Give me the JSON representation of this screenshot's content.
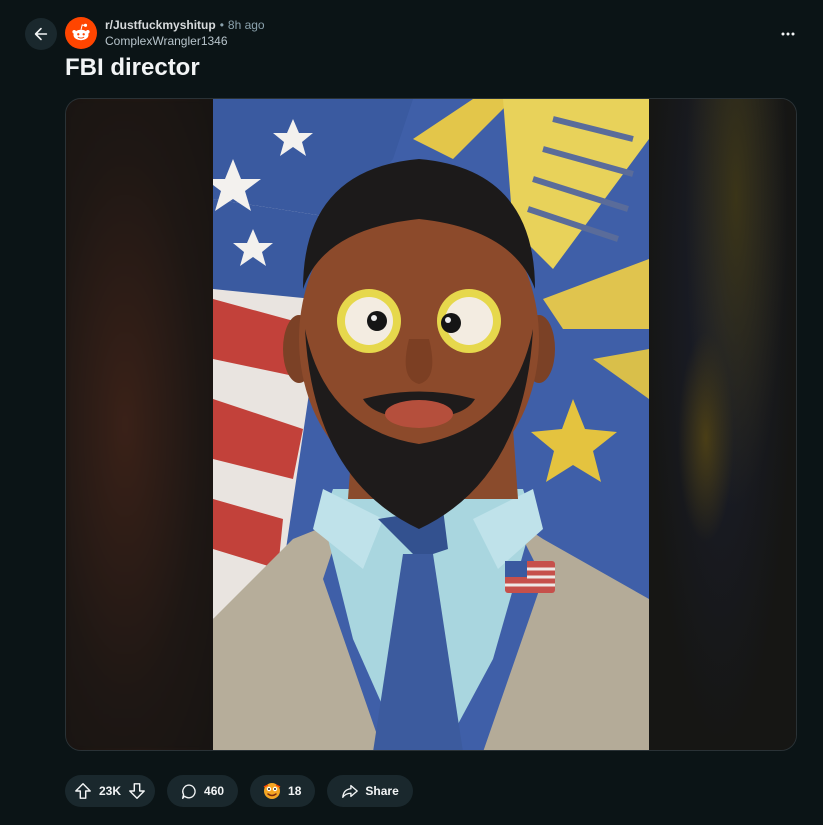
{
  "post": {
    "subreddit": "r/Justfuckmyshitup",
    "separator": "•",
    "time_ago": "8h ago",
    "author": "ComplexWrangler1346",
    "title": "FBI director"
  },
  "actions": {
    "upvotes": "23K",
    "comments": "460",
    "awards": "18",
    "share_label": "Share"
  },
  "icons": {
    "back": "back-arrow-icon",
    "more": "more-options-icon",
    "upvote": "upvote-icon",
    "downvote": "downvote-icon",
    "comment": "comment-icon",
    "award": "award-icon",
    "share": "share-icon"
  },
  "colors": {
    "background": "#0b1416",
    "pill": "#1a282d",
    "subreddit_icon": "#ff4500"
  }
}
